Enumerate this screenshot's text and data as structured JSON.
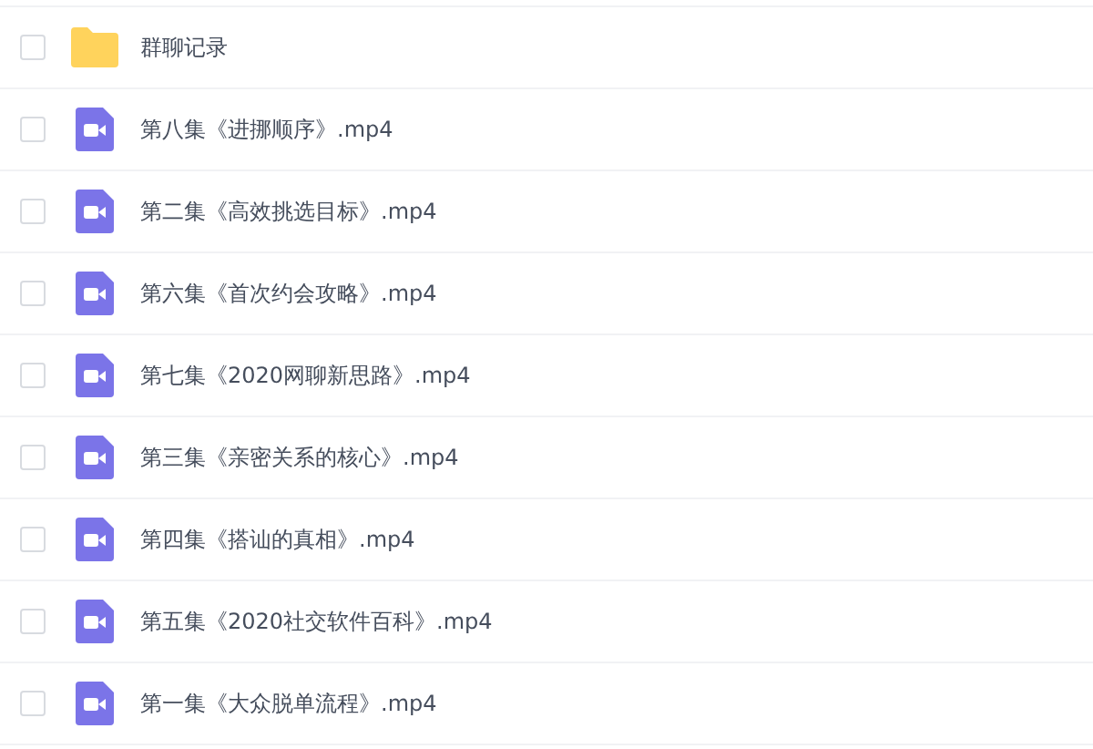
{
  "files": [
    {
      "kind": "folder",
      "name": "群聊记录",
      "checked": false
    },
    {
      "kind": "video",
      "name": "第八集《进挪顺序》.mp4",
      "checked": false
    },
    {
      "kind": "video",
      "name": "第二集《高效挑选目标》.mp4",
      "checked": false
    },
    {
      "kind": "video",
      "name": "第六集《首次约会攻略》.mp4",
      "checked": false
    },
    {
      "kind": "video",
      "name": "第七集《2020网聊新思路》.mp4",
      "checked": false
    },
    {
      "kind": "video",
      "name": "第三集《亲密关系的核心》.mp4",
      "checked": false
    },
    {
      "kind": "video",
      "name": "第四集《搭讪的真相》.mp4",
      "checked": false
    },
    {
      "kind": "video",
      "name": "第五集《2020社交软件百科》.mp4",
      "checked": false
    },
    {
      "kind": "video",
      "name": "第一集《大众脱单流程》.mp4",
      "checked": false
    }
  ]
}
